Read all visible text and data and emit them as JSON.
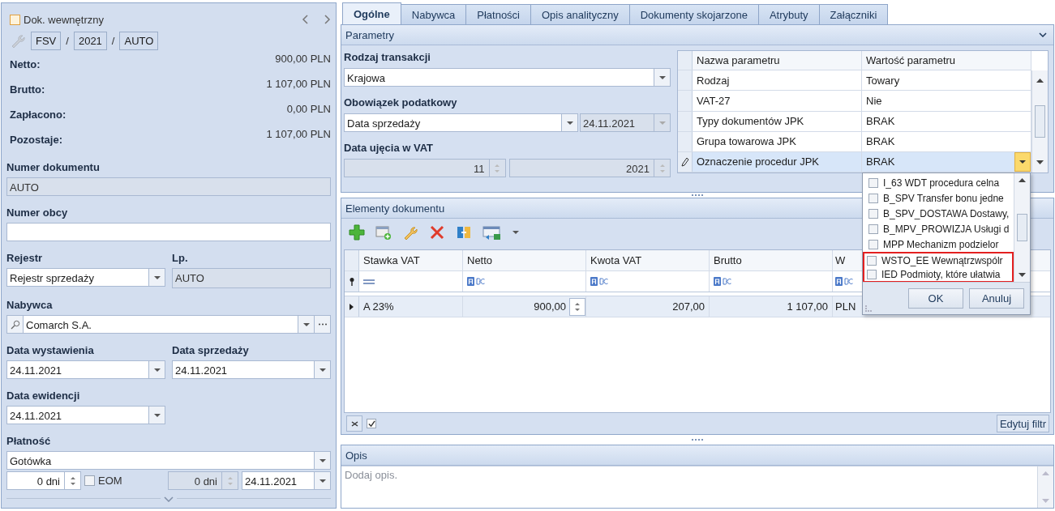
{
  "left": {
    "internal_doc": {
      "label": "Dok. wewnętrzny",
      "checked": false
    },
    "number": {
      "parts": [
        "FSV",
        "2021",
        "AUTO"
      ],
      "separators": [
        "/",
        "/"
      ]
    },
    "totals": [
      {
        "label": "Netto:",
        "value": "900,00 PLN"
      },
      {
        "label": "Brutto:",
        "value": "1 107,00 PLN"
      },
      {
        "label": "Zapłacono:",
        "value": "0,00 PLN"
      },
      {
        "label": "Pozostaje:",
        "value": "1 107,00 PLN"
      }
    ],
    "document_number": {
      "label": "Numer dokumentu",
      "value": "AUTO",
      "disabled": true
    },
    "external_number": {
      "label": "Numer obcy",
      "disabled": false
    },
    "register": {
      "label": "Rejestr",
      "value": "Rejestr sprzedaży"
    },
    "lp": {
      "label": "Lp.",
      "value": "AUTO",
      "disabled": true
    },
    "buyer": {
      "label": "Nabywca",
      "value": "Comarch S.A."
    },
    "issue_date": {
      "label": "Data wystawienia",
      "value": "24.11.2021"
    },
    "sale_date": {
      "label": "Data sprzedaży",
      "value": "24.11.2021"
    },
    "record_date": {
      "label": "Data ewidencji",
      "value": "24.11.2021"
    },
    "payment": {
      "label": "Płatność",
      "value": "Gotówka"
    },
    "term": {
      "value": "0 dni",
      "disabled": false
    },
    "eom": {
      "label": "EOM",
      "checked": false
    },
    "term_2": {
      "value": "0 dni",
      "disabled": true
    },
    "due_date": {
      "value": "24.11.2021"
    }
  },
  "tabs": [
    {
      "label": "Ogólne",
      "selected": true
    },
    {
      "label": "Nabywca",
      "selected": false
    },
    {
      "label": "Płatności",
      "selected": false
    },
    {
      "label": "Opis analityczny",
      "selected": false
    },
    {
      "label": "Dokumenty skojarzone",
      "selected": false
    },
    {
      "label": "Atrybuty",
      "selected": false
    },
    {
      "label": "Załączniki",
      "selected": false
    }
  ],
  "parametry": {
    "title": "Parametry",
    "transaction_type": {
      "label": "Rodzaj transakcji",
      "value": "Krajowa"
    },
    "tax_obligation": {
      "label": "Obowiązek podatkowy",
      "value": "Data sprzedaży",
      "date": "24.11.2021",
      "date_disabled": true
    },
    "vat_period": {
      "label": "Data ujęcia w VAT",
      "month": "11",
      "year": "2021",
      "disabled": true
    },
    "grid": {
      "columns": [
        "Nazwa parametru",
        "Wartość parametru"
      ],
      "rows": [
        {
          "name": "Rodzaj",
          "value": "Towary",
          "selected": false
        },
        {
          "name": "VAT-27",
          "value": "Nie",
          "selected": false
        },
        {
          "name": "Typy dokumentów JPK",
          "value": "BRAK",
          "selected": false
        },
        {
          "name": "Grupa towarowa JPK",
          "value": "BRAK",
          "selected": false
        },
        {
          "name": "Oznaczenie procedur JPK",
          "value": "BRAK",
          "selected": true
        }
      ]
    }
  },
  "dropdown": {
    "items": [
      {
        "label": "I_63 WDT procedura celna",
        "checked": false,
        "highlighted": false
      },
      {
        "label": "B_SPV Transfer bonu jedne",
        "checked": false,
        "highlighted": false
      },
      {
        "label": "B_SPV_DOSTAWA Dostawy,",
        "checked": false,
        "highlighted": false
      },
      {
        "label": "B_MPV_PROWIZJA Usługi d",
        "checked": false,
        "highlighted": false
      },
      {
        "label": "MPP Mechanizm podzielor",
        "checked": false,
        "highlighted": false
      },
      {
        "label": "WSTO_EE Wewnątrzwspólr",
        "checked": false,
        "highlighted": true
      },
      {
        "label": "IED Podmioty, które ułatwia",
        "checked": false,
        "highlighted": true
      }
    ],
    "buttons": [
      "OK",
      "Anuluj"
    ]
  },
  "elementy": {
    "title": "Elementy dokumentu",
    "columns": [
      "Stawka VAT",
      "Netto",
      "Kwota VAT",
      "Brutto",
      "W"
    ],
    "rows": [
      {
        "cells": [
          "A 23%",
          "900,00",
          "207,00",
          "1 107,00",
          "PLN"
        ],
        "selected": true
      }
    ],
    "filter_enabled": true,
    "filter_button": "Edytuj filtr"
  },
  "opis": {
    "title": "Opis",
    "placeholder": "Dodaj opis."
  }
}
